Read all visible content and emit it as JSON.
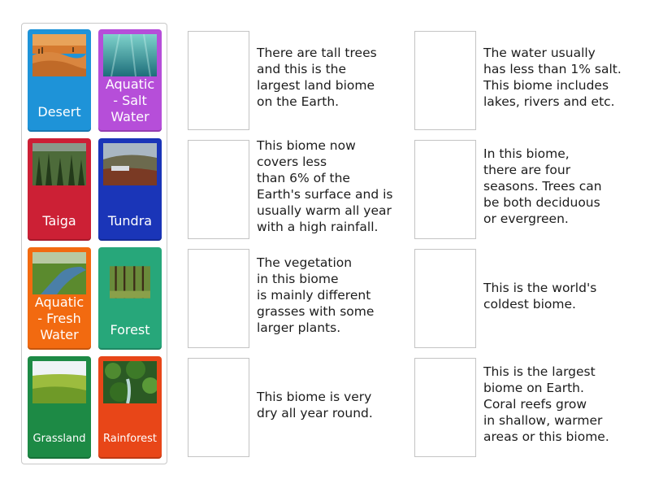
{
  "colors": {
    "desert": "#1e93d8",
    "aquatic_salt": "#b64ed9",
    "taiga": "#cc2035",
    "tundra": "#1a35b8",
    "aquatic_fresh": "#f26a10",
    "forest": "#27a77a",
    "grassland": "#1d8a45",
    "rainforest": "#e84618"
  },
  "cards": {
    "desert": "Desert",
    "aquatic_salt": "Aquatic\n- Salt\nWater",
    "taiga": "Taiga",
    "tundra": "Tundra",
    "aquatic_fresh": "Aquatic\n- Fresh\nWater",
    "forest": "Forest",
    "grassland": "Grassland",
    "rainforest": "Rainforest"
  },
  "descriptions": {
    "left": [
      "There are tall trees\nand this is the\nlargest land biome\non the Earth.",
      "This biome now\ncovers less\nthan 6% of the\nEarth's surface and is\nusually warm all year\nwith a high rainfall.",
      "The vegetation\nin this biome\nis mainly different\ngrasses with some\nlarger plants.",
      "This biome is very\ndry all year round."
    ],
    "right": [
      "The water usually\nhas less than 1% salt.\nThis biome includes\nlakes, rivers and etc.",
      "In this biome,\nthere are four\nseasons. Trees can\nbe both deciduous\nor evergreen.",
      "This is the world's\ncoldest biome.",
      "This is the largest\nbiome on Earth.\nCoral reefs grow\nin shallow, warmer\nareas or this biome."
    ]
  }
}
